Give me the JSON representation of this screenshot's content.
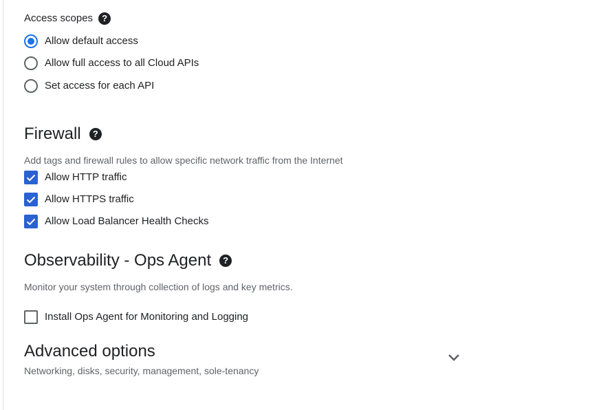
{
  "access_scopes": {
    "label": "Access scopes",
    "help_icon": "help-icon",
    "options": [
      {
        "label": "Allow default access",
        "checked": true
      },
      {
        "label": "Allow full access to all Cloud APIs",
        "checked": false
      },
      {
        "label": "Set access for each API",
        "checked": false
      }
    ]
  },
  "firewall": {
    "title": "Firewall",
    "help_icon": "help-icon",
    "description": "Add tags and firewall rules to allow specific network traffic from the Internet",
    "options": [
      {
        "label": "Allow HTTP traffic",
        "checked": true
      },
      {
        "label": "Allow HTTPS traffic",
        "checked": true
      },
      {
        "label": "Allow Load Balancer Health Checks",
        "checked": true
      }
    ]
  },
  "observability": {
    "title": "Observability - Ops Agent",
    "help_icon": "help-icon",
    "description": "Monitor your system through collection of logs and key metrics.",
    "options": [
      {
        "label": "Install Ops Agent for Monitoring and Logging",
        "checked": false
      }
    ]
  },
  "advanced": {
    "title": "Advanced options",
    "description": "Networking, disks, security, management, sole-tenancy",
    "expand_icon": "chevron-down-icon"
  },
  "colors": {
    "accent": "#1a73e8",
    "checkbox_fill": "#2b62d1",
    "text": "#202124",
    "muted_text": "#5f6368"
  }
}
